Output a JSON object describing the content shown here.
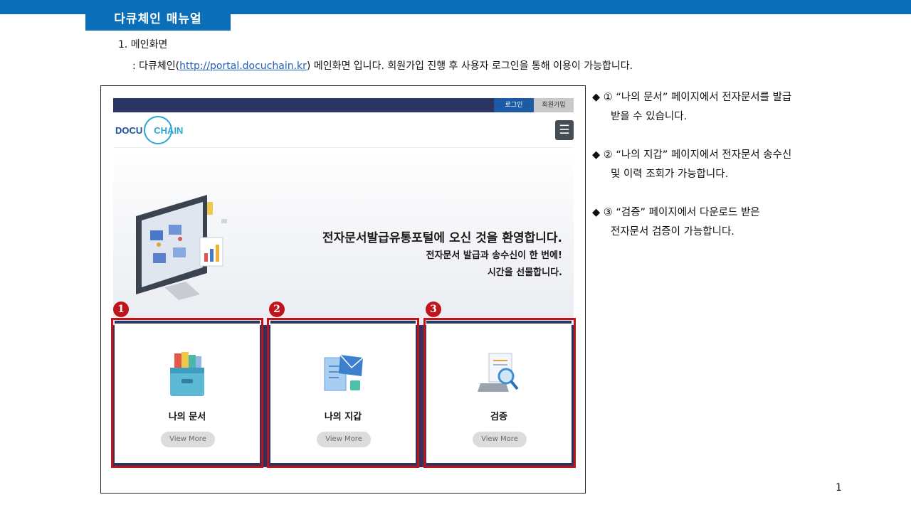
{
  "header": {
    "title": "다큐체인 매뉴얼"
  },
  "section": {
    "heading": "1. 메인화면",
    "desc_prefix": ": 다큐체인(",
    "desc_link": "http://portal.docuchain.kr",
    "desc_suffix": ") 메인화면 입니다. 회원가입 진행 후 사용자 로그인을 통해 이용이 가능합니다."
  },
  "site": {
    "login_label": "로그인",
    "signup_label": "회원가입",
    "logo_left": "DOCU",
    "logo_right": "CHAIN",
    "menu_icon": "☰",
    "hero_title": "전자문서발급유통포털에 오신 것을 환영합니다.",
    "hero_sub1": "전자문서 발급과 송수신이 한 번에!",
    "hero_sub2": "시간을 선물합니다.",
    "cards": [
      {
        "number": "1",
        "label": "나의 문서",
        "button": "View More",
        "icon": "file-box-icon"
      },
      {
        "number": "2",
        "label": "나의 지갑",
        "button": "View More",
        "icon": "mail-document-icon"
      },
      {
        "number": "3",
        "label": "검증",
        "button": "View More",
        "icon": "magnifier-document-icon"
      }
    ]
  },
  "bullets": [
    {
      "line1": "◆  ① “나의 문서” 페이지에서 전자문서를 발급",
      "line2": "받을 수 있습니다."
    },
    {
      "line1": "◆  ② “나의 지갑” 페이지에서 전자문서 송수신",
      "line2": "및 이력 조회가 가능합니다."
    },
    {
      "line1": "◆  ③ “검증” 페이지에서 다운로드 받은",
      "line2": "전자문서 검증이 가능합니다."
    }
  ],
  "page_number": "1",
  "colors": {
    "header_blue": "#0a6fb8",
    "navy": "#2c3561",
    "highlight_red": "#c0141b"
  }
}
